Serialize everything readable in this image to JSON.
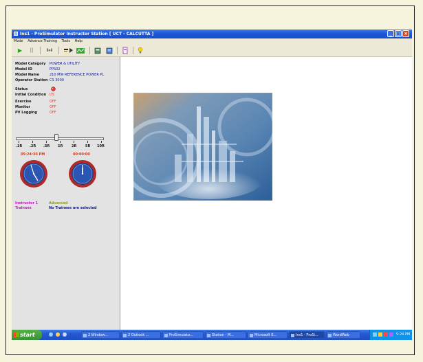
{
  "window": {
    "title": "Ins1 - ProSimulator Instructor Station [ UCT - CALCUTTA ]",
    "min_glyph": "_",
    "max_glyph": "□",
    "close_glyph": "×"
  },
  "menu": {
    "items": [
      "Mode",
      "Advance Training",
      "Tools",
      "Help"
    ]
  },
  "toolbar": {
    "play_glyph": "▶",
    "pause_glyph": "||",
    "step_label": "I»I"
  },
  "model_info": {
    "category_label": "Model Category",
    "category_value": "POWER & UTILITY",
    "id_label": "Model ID",
    "id_value": "PPS02",
    "name_label": "Model Name",
    "name_value": "210 MW REFERENCE POWER PL",
    "station_label": "Operator Station",
    "station_value": "CS 3000"
  },
  "status": {
    "status_label": "Status",
    "ic_label": "Initial Condition",
    "ic_value": "DS",
    "exercise_label": "Exercise",
    "exercise_value": "OFF",
    "monitor_label": "Monitor",
    "monitor_value": "OFF",
    "pv_label": "PV Logging",
    "pv_value": "OFF"
  },
  "speed_slider": {
    "ticks": [
      ".1R",
      ".2R",
      ".5R",
      "1R",
      "2R",
      "5R",
      "10R"
    ],
    "selected": "1R"
  },
  "clocks": {
    "real_time": "05:24:30 PM",
    "sim_time": "00:00:00"
  },
  "instructor": {
    "instructor_label": "Instructor 1",
    "instructor_value": "Advanced",
    "trainees_label": "Trainees",
    "trainees_value": "No Trainees are selected"
  },
  "colors": {
    "value_blue": "#0a1aa0",
    "off_red": "#e0402a",
    "clock_red": "#d63a1a",
    "instructor_magenta": "#c020c0",
    "instructor_green": "#88a020"
  },
  "taskbar": {
    "start_label": "start",
    "items": [
      "2 Window...",
      "2 Outlook ...",
      "ProSimulato...",
      "Station - M...",
      "Microsoft E...",
      "Ins1 - ProSi...",
      "WordWeb"
    ],
    "clock": "5:24 PM"
  }
}
